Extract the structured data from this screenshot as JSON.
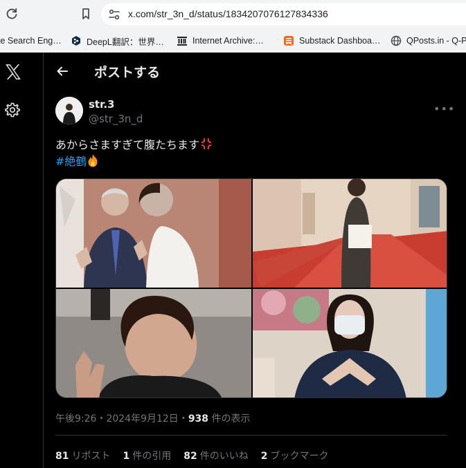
{
  "browser": {
    "url": "x.com/str_3n_d/status/1834207076127834336",
    "bookmarks": [
      {
        "label": "te Search Eng…",
        "icon": "generic"
      },
      {
        "label": "DeepL翻訳：世界…",
        "icon": "deepl-icon"
      },
      {
        "label": "Internet Archive:…",
        "icon": "archive-icon"
      },
      {
        "label": "Substack Dashboa…",
        "icon": "substack-icon"
      },
      {
        "label": "QPosts.in - Q-Po",
        "icon": "globe-icon"
      }
    ]
  },
  "header": {
    "title": "ポストする"
  },
  "tweet": {
    "display_name": "str.3",
    "handle": "@str_3n_d",
    "text_line1": "あからさますぎて腹たちます",
    "hashtag": "#絶鶴",
    "images": [
      {
        "alt": "photo-1"
      },
      {
        "alt": "photo-2"
      },
      {
        "alt": "photo-3"
      },
      {
        "alt": "photo-4"
      }
    ],
    "time": "午後9:26",
    "sep1": "・",
    "date": "2024年9月12日",
    "sep2": "・",
    "views_count": "938",
    "views_label": "件の表示"
  },
  "stats": [
    {
      "count": "81",
      "label": "リポスト"
    },
    {
      "count": "1",
      "label": "件の引用"
    },
    {
      "count": "82",
      "label": "件のいいね"
    },
    {
      "count": "2",
      "label": "ブックマーク"
    }
  ],
  "colors": {
    "background": "#000000",
    "text": "#e7e9ea",
    "muted": "#71767b",
    "link": "#1d9bf0",
    "border": "#2f3336"
  }
}
